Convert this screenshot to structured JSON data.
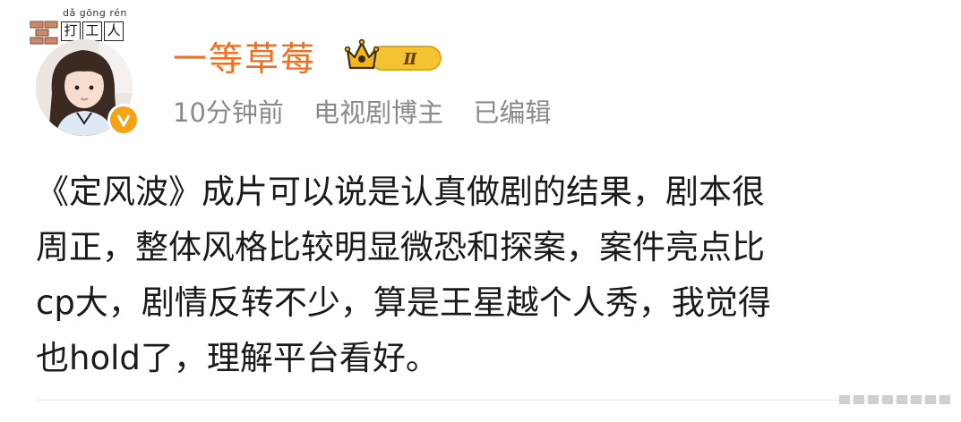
{
  "post": {
    "author": "一等草莓",
    "meta": {
      "time": "10分钟前",
      "role": "电视剧博主",
      "edited": "已编辑"
    },
    "level_badge": "Ⅱ",
    "sticker": {
      "pinyin": "dǎ gōng rén",
      "chars": [
        "打",
        "工",
        "人"
      ]
    },
    "content_lines": [
      "《定风波》成片可以说是认真做剧的结果，剧本很",
      "周正，整体风格比较明显微恐和探案，案件亮点比",
      "cp大，剧情反转不少，算是王星越个人秀，我觉得",
      "也hold了，理解平台看好。"
    ]
  },
  "colors": {
    "username": "#f26d1f",
    "meta": "#8a8a8a",
    "verified": "#f2a414",
    "text": "#1a1a1a",
    "badge_gold": "#f5c233"
  },
  "icons": {
    "verified": "verified-v-icon",
    "crown": "crown-icon"
  }
}
